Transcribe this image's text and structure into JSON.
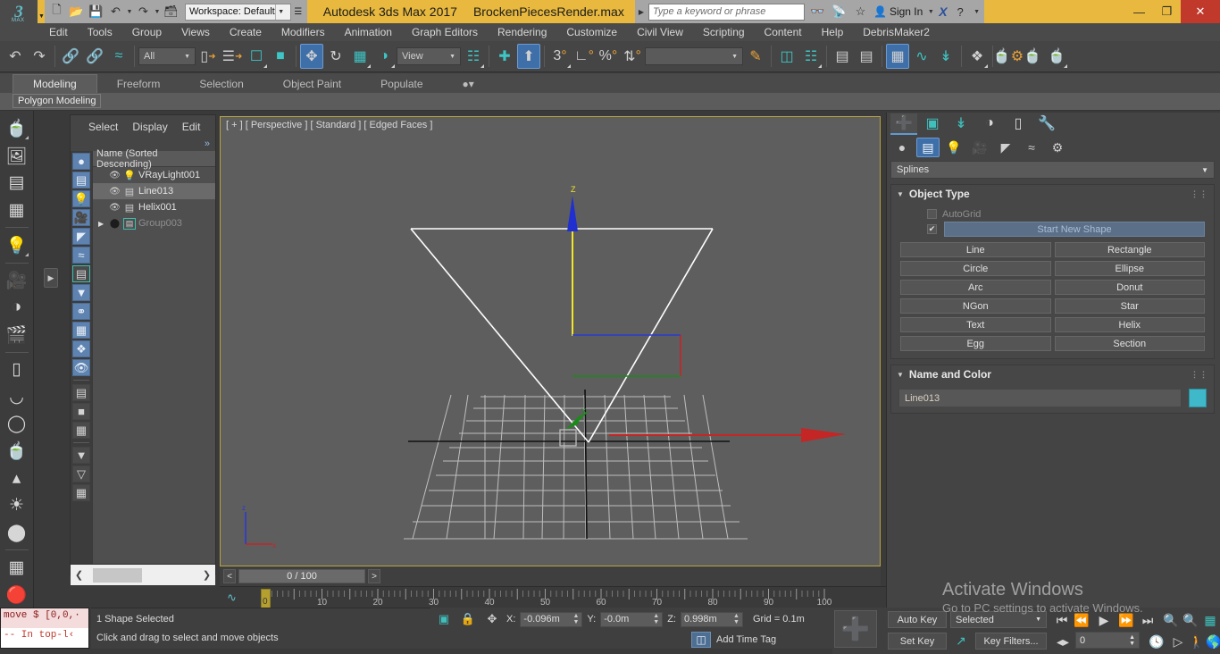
{
  "titlebar": {
    "logo_text": "3",
    "logo_sub": "MAX",
    "workspace_label": "Workspace: Default",
    "app_title": "Autodesk 3ds Max 2017",
    "file_title": "BrockenPiecesRender.max",
    "search_placeholder": "Type a keyword or phrase",
    "signin_label": "Sign In",
    "x_logo": "X",
    "quick_icons": [
      "new-file-icon",
      "open-file-icon",
      "save-icon",
      "undo-icon",
      "redo-icon",
      "set-project-icon"
    ],
    "help_icon": "?",
    "minimize": "—",
    "maximize": "❐",
    "close": "✕"
  },
  "menubar": {
    "items": [
      "Edit",
      "Tools",
      "Group",
      "Views",
      "Create",
      "Modifiers",
      "Animation",
      "Graph Editors",
      "Rendering",
      "Customize",
      "Civil View",
      "Scripting",
      "Content",
      "Help",
      "DebrisMaker2"
    ]
  },
  "toolbar": {
    "selection_filter": "All",
    "reference_coord": "View",
    "named_selection_sets": ""
  },
  "ribbon": {
    "tabs": [
      "Modeling",
      "Freeform",
      "Selection",
      "Object Paint",
      "Populate"
    ],
    "selected_tab": "Modeling",
    "panel_label": "Polygon Modeling"
  },
  "explorer": {
    "menus": [
      "Select",
      "Display",
      "Edit"
    ],
    "chevron": "»",
    "column_header": "Name (Sorted Descending)",
    "rows": [
      {
        "name": "VRayLight001",
        "icon": "light-icon",
        "selected": false,
        "hidden": false,
        "expandable": false
      },
      {
        "name": "Line013",
        "icon": "shape-icon",
        "selected": true,
        "hidden": false,
        "expandable": false
      },
      {
        "name": "Helix001",
        "icon": "shape-icon",
        "selected": false,
        "hidden": false,
        "expandable": false
      },
      {
        "name": "Group003",
        "icon": "group-icon",
        "selected": false,
        "hidden": true,
        "expandable": true
      }
    ]
  },
  "viewport": {
    "label": "[ + ] [ Perspective ] [ Standard ] [ Edged Faces ]",
    "axis_labels": {
      "x": "X",
      "y": "Y",
      "z": "Z"
    },
    "background": "#5e5e5e"
  },
  "timeslider": {
    "prev_label": "<",
    "next_label": ">",
    "current_frame_label": "0 / 100",
    "track_ticks": [
      "0",
      "10",
      "20",
      "30",
      "40",
      "50",
      "60",
      "70",
      "80",
      "90",
      "100"
    ],
    "key_position_label": "0"
  },
  "minilistener": {
    "line1": "move $ [0,0,·",
    "line2": "--  In top-l‹"
  },
  "status": {
    "selection_text": "1 Shape Selected",
    "prompt_text": "Click and drag to select and move objects"
  },
  "coords": {
    "x_label": "X:",
    "x_value": "-0.096m",
    "y_label": "Y:",
    "y_value": "-0.0m",
    "z_label": "Z:",
    "z_value": "0.998m",
    "grid_label": "Grid = 0.1m",
    "add_time_tag": "Add Time Tag"
  },
  "anim": {
    "auto_key": "Auto Key",
    "set_key": "Set Key",
    "selection_list": "Selected",
    "key_filters": "Key Filters...",
    "frame_field": "0"
  },
  "cmdpanel": {
    "tabs": [
      "create-tab",
      "modify-tab",
      "hierarchy-tab",
      "motion-tab",
      "display-tab",
      "utilities-tab"
    ],
    "selected_tab_index": 0,
    "subtabs": [
      "geometry-icon",
      "shapes-icon",
      "lights-icon",
      "cameras-icon",
      "helpers-icon",
      "space-warps-icon",
      "systems-icon"
    ],
    "selected_subtab_index": 1,
    "category": "Splines",
    "object_type": {
      "title": "Object Type",
      "autogrid_label": "AutoGrid",
      "autogrid_checked": false,
      "start_new_shape_label": "Start New Shape",
      "start_new_shape_checked": true,
      "buttons": [
        "Line",
        "Rectangle",
        "Circle",
        "Ellipse",
        "Arc",
        "Donut",
        "NGon",
        "Star",
        "Text",
        "Helix",
        "Egg",
        "Section"
      ]
    },
    "name_and_color": {
      "title": "Name and Color",
      "name_value": "Line013",
      "color": "#3fb8c9"
    }
  },
  "watermark": {
    "line1": "Activate Windows",
    "line2": "Go to PC settings to activate Windows."
  },
  "colors": {
    "title_bar": "#e8b93e",
    "accent_blue": "#3f6fa8",
    "accent_teal": "#3fc0bd",
    "viewport_border": "#b9a33e",
    "close_red": "#c0392b"
  }
}
